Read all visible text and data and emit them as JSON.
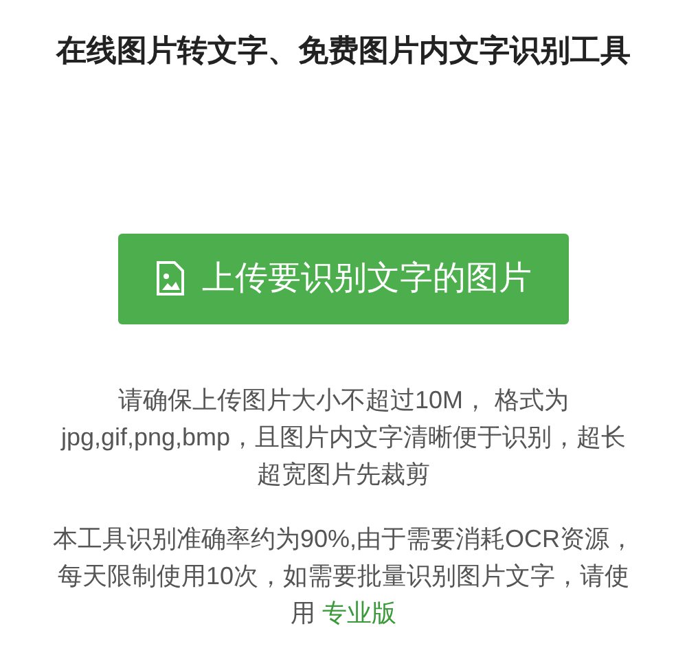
{
  "title": "在线图片转文字、免费图片内文字识别工具",
  "upload_button": {
    "label": "上传要识别文字的图片"
  },
  "note_lines": [
    "请确保上传图片大小不超过10M，  格式为",
    "jpg,gif,png,bmp，且图片内文字清晰便于识别，超长",
    "超宽图片先裁剪"
  ],
  "info": {
    "lines": [
      "本工具识别准确率约为90%,由于需要消耗OCR资源，",
      "每天限制使用10次，如需要批量识别图片文字，请使",
      "用 "
    ],
    "link": "专业版"
  }
}
